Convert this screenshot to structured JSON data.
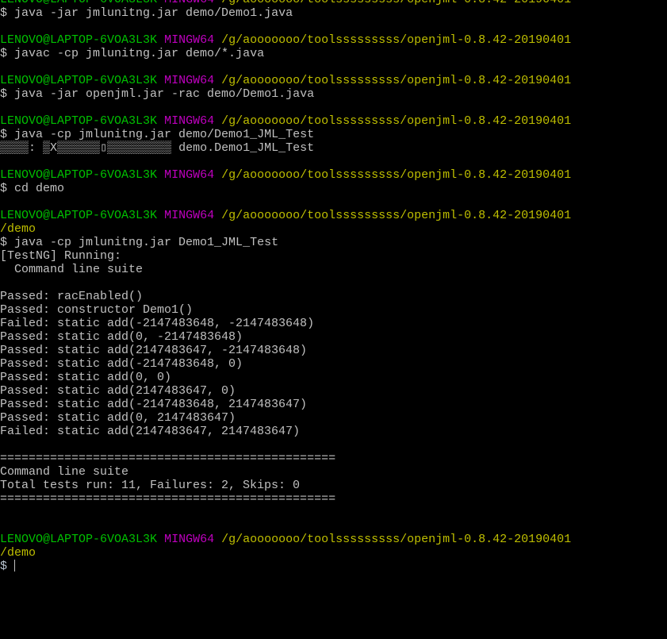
{
  "colors": {
    "user": "#00c000",
    "host_env": "#c000c0",
    "path": "#bfbf00",
    "text": "#c0c0c0",
    "dollar": "#b8c4d0"
  },
  "prompt": {
    "user": "LENOVO@LAPTOP-6VOA3L3K",
    "env": "MINGW64",
    "path": "/g/aooooooo/toolsssssssss/openjml-0.8.42-20190401"
  },
  "lines": [
    {
      "type": "prompt"
    },
    {
      "type": "cmd",
      "text": "java -jar jmlunitng.jar demo/Demo1.java"
    },
    {
      "type": "blank"
    },
    {
      "type": "prompt"
    },
    {
      "type": "cmd",
      "text": "javac -cp jmlunitng.jar demo/*.java"
    },
    {
      "type": "blank"
    },
    {
      "type": "prompt"
    },
    {
      "type": "cmd",
      "text": "java -jar openjml.jar -rac demo/Demo1.java"
    },
    {
      "type": "blank"
    },
    {
      "type": "prompt"
    },
    {
      "type": "cmd",
      "text": "java -cp jmlunitng.jar demo/Demo1_JML_Test"
    },
    {
      "type": "out",
      "text": "▒▒▒▒: ▒X▒▒▒▒▒▒▯▒▒▒▒▒▒▒▒▒ demo.Demo1_JML_Test"
    },
    {
      "type": "blank"
    },
    {
      "type": "prompt"
    },
    {
      "type": "cmd",
      "text": "cd demo"
    },
    {
      "type": "blank"
    },
    {
      "type": "prompt"
    },
    {
      "type": "subpath",
      "text": "/demo"
    },
    {
      "type": "cmd",
      "text": "java -cp jmlunitng.jar Demo1_JML_Test"
    },
    {
      "type": "out",
      "text": "[TestNG] Running:"
    },
    {
      "type": "out",
      "text": "  Command line suite"
    },
    {
      "type": "blank"
    },
    {
      "type": "out",
      "text": "Passed: racEnabled()"
    },
    {
      "type": "out",
      "text": "Passed: constructor Demo1()"
    },
    {
      "type": "out",
      "text": "Failed: static add(-2147483648, -2147483648)"
    },
    {
      "type": "out",
      "text": "Passed: static add(0, -2147483648)"
    },
    {
      "type": "out",
      "text": "Passed: static add(2147483647, -2147483648)"
    },
    {
      "type": "out",
      "text": "Passed: static add(-2147483648, 0)"
    },
    {
      "type": "out",
      "text": "Passed: static add(0, 0)"
    },
    {
      "type": "out",
      "text": "Passed: static add(2147483647, 0)"
    },
    {
      "type": "out",
      "text": "Passed: static add(-2147483648, 2147483647)"
    },
    {
      "type": "out",
      "text": "Passed: static add(0, 2147483647)"
    },
    {
      "type": "out",
      "text": "Failed: static add(2147483647, 2147483647)"
    },
    {
      "type": "blank"
    },
    {
      "type": "out",
      "text": "==============================================="
    },
    {
      "type": "out",
      "text": "Command line suite"
    },
    {
      "type": "out",
      "text": "Total tests run: 11, Failures: 2, Skips: 0"
    },
    {
      "type": "out",
      "text": "==============================================="
    },
    {
      "type": "blank"
    },
    {
      "type": "blank"
    },
    {
      "type": "prompt"
    },
    {
      "type": "subpath",
      "text": "/demo"
    },
    {
      "type": "input",
      "text": ""
    }
  ]
}
